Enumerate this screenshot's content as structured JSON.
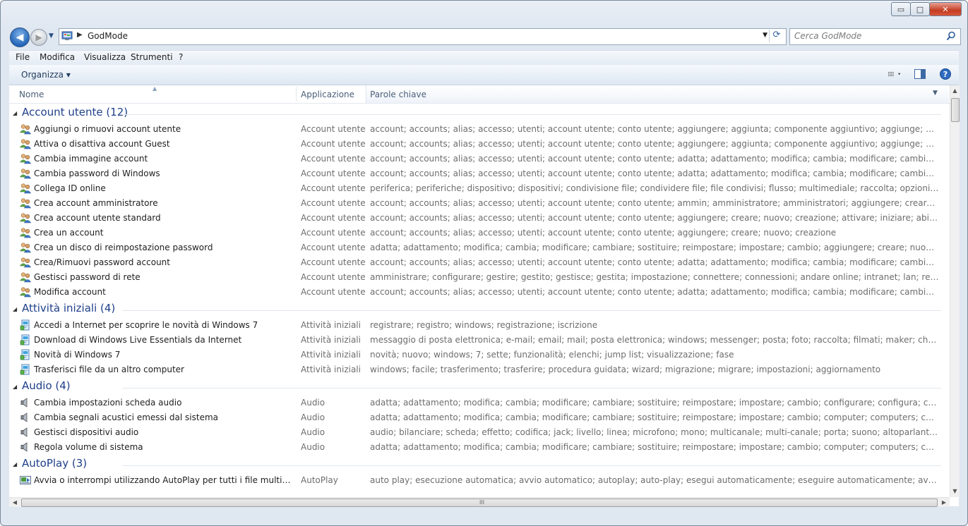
{
  "window": {
    "controls": {
      "minimize": "▭",
      "maximize": "□",
      "close": "✕"
    }
  },
  "nav": {
    "back_glyph": "◀",
    "forward_glyph": "▶",
    "address": {
      "separator": "▶",
      "path": "GodMode",
      "dropdown": "▼",
      "refresh_glyph": "⟳"
    },
    "search": {
      "placeholder": "Cerca GodMode"
    }
  },
  "menubar": {
    "items": [
      "File",
      "Modifica",
      "Visualizza",
      "Strumenti",
      "?"
    ]
  },
  "toolbar": {
    "organize_label": "Organizza ▾"
  },
  "columns": {
    "name": "Nome",
    "app": "Applicazione",
    "keywords": "Parole chiave",
    "sort_glyph": "▲",
    "dropdown_glyph": "▼"
  },
  "colors": {
    "group_title": "#1e3f8a",
    "secondary_text": "#6d6d6d"
  },
  "groups": [
    {
      "title": "Account utente (12)",
      "icon": "users-icon",
      "items": [
        {
          "name": "Aggiungi o rimuovi account utente",
          "app": "Account utente",
          "keywords": "account; accounts; alias; accesso; utenti; account utente; conto utente; aggiungere; aggiunta; componente aggiuntivo; aggiunge; attivare; iniziare; abil..."
        },
        {
          "name": "Attiva o disattiva account Guest",
          "app": "Account utente",
          "keywords": "account; accounts; alias; accesso; utenti; account utente; conto utente; aggiungere; aggiunta; componente aggiuntivo; aggiunge; attivare; iniziare; abil..."
        },
        {
          "name": "Cambia immagine account",
          "app": "Account utente",
          "keywords": "account; accounts; alias; accesso; utenti; account utente; conto utente; adatta; adattamento; modifica; cambia; modificare; cambiare; sostituire; reimp..."
        },
        {
          "name": "Cambia password di Windows",
          "app": "Account utente",
          "keywords": "account; accounts; alias; accesso; utenti; account utente; conto utente; adatta; adattamento; modifica; cambia; modificare; cambiare; sostituire; reimp..."
        },
        {
          "name": "Collega ID online",
          "app": "Account utente",
          "keywords": "periferica; periferiche; dispositivo; dispositivi; condivisione file; condividere file; file condivisi; flusso; multimediale; raccolta; opzioni; con; per; condivisi..."
        },
        {
          "name": "Crea account amministratore",
          "app": "Account utente",
          "keywords": "account; accounts; alias; accesso; utenti; account utente; conto utente; ammin; amministratore; amministratori; aggiungere; creare; nuovo; creazione; ..."
        },
        {
          "name": "Crea account utente standard",
          "app": "Account utente",
          "keywords": "account; accounts; alias; accesso; utenti; account utente; conto utente; aggiungere; creare; nuovo; creazione; attivare; iniziare; abilitare; istallare; richia..."
        },
        {
          "name": "Crea un account",
          "app": "Account utente",
          "keywords": "account; accounts; alias; accesso; utenti; account utente; conto utente; aggiungere; creare; nuovo; creazione"
        },
        {
          "name": "Crea un disco di reimpostazione password",
          "app": "Account utente",
          "keywords": "adatta; adattamento; modifica; cambia; modificare; cambiare; sostituire; reimpostare; impostare; cambio; aggiungere; creare; nuovo; creazione; disco; ..."
        },
        {
          "name": "Crea/Rimuovi password account",
          "app": "Account utente",
          "keywords": "account; accounts; alias; accesso; utenti; account utente; conto utente; adatta; adattamento; modifica; cambia; modificare; cambiare; sostituire; reimp..."
        },
        {
          "name": "Gestisci password di rete",
          "app": "Account utente",
          "keywords": "amministrare; configurare; gestire; gestito; gestisce; gestita; impostazione; connettere; connessioni; andare online; intranet; lan; rete; reti; connessioni r..."
        },
        {
          "name": "Modifica account",
          "app": "Account utente",
          "keywords": "account; accounts; alias; accesso; utenti; account utente; conto utente; adatta; adattamento; modifica; cambia; modificare; cambiare; sostituire; reimp..."
        }
      ]
    },
    {
      "title": "Attività iniziali (4)",
      "icon": "getting-started-icon",
      "items": [
        {
          "name": "Accedi a Internet per scoprire le novità di Windows 7",
          "app": "Attività iniziali",
          "keywords": "registrare; registro; windows; registrazione; iscrizione"
        },
        {
          "name": "Download di Windows Live Essentials da Internet",
          "app": "Attività iniziali",
          "keywords": "messaggio di posta elettronica; e-mail; email; mail; posta elettronica; windows; messenger; posta; foto; raccolta; filmati; maker; chat; im; messaggistic..."
        },
        {
          "name": "Novità di Windows 7",
          "app": "Attività iniziali",
          "keywords": "novità; nuovo; windows; 7; sette; funzionalità; elenchi; jump list; visualizzazione; fase"
        },
        {
          "name": "Trasferisci file da un altro computer",
          "app": "Attività iniziali",
          "keywords": "windows; facile; trasferimento; trasferire; procedura guidata; wizard; migrazione; migrare; impostazioni; aggiornamento"
        }
      ]
    },
    {
      "title": "Audio (4)",
      "icon": "speaker-icon",
      "items": [
        {
          "name": "Cambia impostazioni scheda audio",
          "app": "Audio",
          "keywords": "adatta; adattamento; modifica; cambia; modificare; cambiare; sostituire; reimpostare; impostare; cambio; configurare; configura; configurazione; confi..."
        },
        {
          "name": "Cambia segnali acustici emessi dal sistema",
          "app": "Audio",
          "keywords": "adatta; adattamento; modifica; cambia; modificare; cambiare; sostituire; reimpostare; impostare; cambio; computer; computers; calcolatore; compute..."
        },
        {
          "name": "Gestisci dispositivi audio",
          "app": "Audio",
          "keywords": "audio; bilanciare; scheda; effetto; codifica; jack; livello; linea; microfono; mono; multicanale; multi-canale; porta; suono; altoparlante; stereo; subwoofe..."
        },
        {
          "name": "Regola volume di sistema",
          "app": "Audio",
          "keywords": "adatta; adattamento; modifica; cambia; modificare; cambiare; sostituire; reimpostare; impostare; cambio; computer; computers; calcolatore; compute..."
        }
      ]
    },
    {
      "title": "AutoPlay (3)",
      "icon": "autoplay-icon",
      "items": [
        {
          "name": "Avvia o interrompi utilizzando AutoPlay per tutti i file multimediali ...",
          "app": "AutoPlay",
          "keywords": "auto play; esecuzione automatica; avvio automatico; autoplay; auto-play; esegui automaticamente; eseguire automaticamente; avviare automaticame..."
        }
      ]
    }
  ],
  "scrollbars": {
    "up": "▲",
    "down": "▼",
    "left": "◀",
    "right": "▶",
    "grip": "III"
  }
}
